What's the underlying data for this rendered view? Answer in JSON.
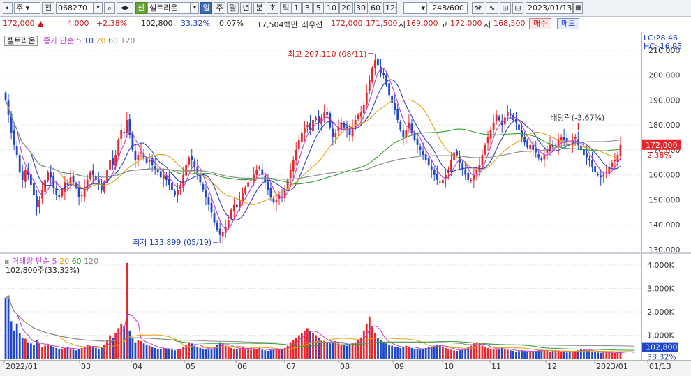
{
  "toolbar": {
    "period_type": "주",
    "prev_label": "전",
    "code": "068270",
    "credit_badge": "신",
    "stock_name": "셀트리온",
    "periods": [
      "일",
      "주",
      "월",
      "년",
      "분",
      "초",
      "틱"
    ],
    "active_period": "일",
    "nums": [
      "1",
      "3",
      "5",
      "10",
      "20",
      "30",
      "60",
      "120"
    ],
    "count": "248/600",
    "date": "2023/01/13"
  },
  "quote": {
    "price": "172,000",
    "change_arrow": "▲",
    "change": "4,000",
    "change_pct": "+2.38%",
    "volume": "102,800",
    "volume_ratio": "33.32%",
    "turnover_pct": "0.07%",
    "trade_value": "17,504백만",
    "best_bid_label": "최우선",
    "best_ask": "172,000",
    "best_bid": "171,500",
    "open_label": "시",
    "open": "169,000",
    "high_label": "고",
    "high": "172,000",
    "low_label": "저",
    "low": "168,500",
    "buy_label": "매수",
    "sell_label": "매도"
  },
  "legend": {
    "name": "셀트리온",
    "ma_label": "종가 단순",
    "ma_periods": [
      "5",
      "10",
      "20",
      "60",
      "120"
    ],
    "vol_label": "거래량 단순",
    "vol_periods": [
      "5",
      "20",
      "60",
      "120"
    ],
    "vol_value": "102,800주(33.32%)"
  },
  "corner": {
    "lc": "LC:28.46",
    "hc": "HC:-16.95"
  },
  "annotations": {
    "high": "최고 207,110 (08/11)",
    "low": "최저 133,899 (05/19)",
    "dividend": "배당락(-3.67%)"
  },
  "price_tags": {
    "price": "172,000",
    "pct": "2.38%"
  },
  "volume_tags": {
    "volume": "102,800",
    "pct": "33.32%"
  },
  "colors": {
    "up": "#e8262b",
    "down": "#2147c9",
    "ma5": "#c23bd6",
    "ma10": "#2f3fbf",
    "ma20": "#e0a010",
    "ma60": "#2ea02e",
    "ma120": "#888888"
  },
  "chart_data": {
    "type": "candlestick",
    "x_ticks": [
      "2022/01",
      "03",
      "04",
      "05",
      "06",
      "07",
      "08",
      "09",
      "10",
      "11",
      "12",
      "2023/01",
      "01/13"
    ],
    "price_axis": {
      "ylim": [
        130000,
        215000
      ],
      "ticks": [
        "130,000",
        "140,000",
        "150,000",
        "160,000",
        "170,000",
        "180,000",
        "190,000",
        "200,000",
        "210,000"
      ]
    },
    "volume_axis": {
      "ylim": [
        0,
        4300
      ],
      "ticks": [
        "1,000K",
        "2,000K",
        "3,000K",
        "4,000K"
      ]
    },
    "close": [
      190000,
      184000,
      177000,
      172000,
      168000,
      161000,
      158000,
      162000,
      160000,
      156000,
      152000,
      147000,
      150000,
      154000,
      158000,
      161000,
      159000,
      155000,
      152000,
      151000,
      154000,
      157000,
      156000,
      159000,
      157000,
      155000,
      151000,
      152000,
      155000,
      158000,
      161000,
      160000,
      158000,
      156000,
      154000,
      157000,
      162000,
      166000,
      164000,
      168000,
      174000,
      178000,
      177000,
      182000,
      176000,
      170000,
      166000,
      168000,
      169000,
      167000,
      165000,
      166000,
      164000,
      162000,
      161000,
      159000,
      160000,
      158000,
      156000,
      154000,
      152000,
      154000,
      156000,
      160000,
      164000,
      167000,
      166000,
      163000,
      160000,
      157000,
      154000,
      151000,
      148000,
      145000,
      141000,
      138000,
      136000,
      137000,
      139000,
      142000,
      146000,
      148000,
      147000,
      150000,
      153000,
      155000,
      157000,
      158000,
      160000,
      162000,
      163000,
      160000,
      157000,
      154000,
      151000,
      149000,
      150000,
      152000,
      151000,
      154000,
      158000,
      162000,
      166000,
      170000,
      174000,
      177000,
      179000,
      180000,
      178000,
      182000,
      183000,
      181000,
      183000,
      185000,
      184000,
      179000,
      175000,
      177000,
      179000,
      181000,
      179000,
      178000,
      176000,
      179000,
      182000,
      184000,
      185000,
      188000,
      193000,
      198000,
      203000,
      206000,
      204000,
      201000,
      200000,
      196000,
      192000,
      189000,
      186000,
      182000,
      178000,
      175000,
      178000,
      181000,
      177000,
      174000,
      172000,
      170000,
      168000,
      166000,
      164000,
      162000,
      160000,
      158000,
      157000,
      158000,
      160000,
      162000,
      166000,
      169000,
      168000,
      165000,
      162000,
      160000,
      158000,
      158000,
      160000,
      162000,
      164000,
      168000,
      172000,
      175000,
      178000,
      181000,
      184000,
      182000,
      180000,
      183000,
      185000,
      184000,
      182000,
      181000,
      178000,
      175000,
      173000,
      171000,
      172000,
      170000,
      169000,
      167000,
      166000,
      168000,
      170000,
      172000,
      171000,
      172000,
      174000,
      175000,
      174000,
      173000,
      172000,
      174000,
      175000,
      172000,
      170000,
      168000,
      167000,
      166000,
      163000,
      161000,
      160000,
      159000,
      160000,
      161000,
      163000,
      165000,
      166000,
      168000,
      172000
    ],
    "volume_k": [
      2600,
      2700,
      1600,
      1200,
      1500,
      1100,
      900,
      850,
      700,
      650,
      600,
      800,
      650,
      500,
      550,
      600,
      550,
      500,
      450,
      420,
      400,
      450,
      500,
      420,
      380,
      350,
      400,
      450,
      500,
      600,
      550,
      500,
      450,
      420,
      500,
      600,
      800,
      1000,
      900,
      1100,
      1300,
      1500,
      1400,
      4100,
      1200,
      900,
      700,
      800,
      750,
      650,
      600,
      550,
      500,
      450,
      420,
      400,
      450,
      420,
      400,
      380,
      350,
      380,
      420,
      500,
      600,
      700,
      650,
      550,
      500,
      450,
      420,
      400,
      380,
      400,
      500,
      600,
      700,
      650,
      550,
      500,
      450,
      420,
      400,
      450,
      500,
      420,
      400,
      380,
      400,
      420,
      450,
      380,
      350,
      330,
      350,
      380,
      420,
      400,
      380,
      450,
      550,
      700,
      800,
      900,
      1000,
      1100,
      1200,
      1300,
      1200,
      1100,
      1000,
      900,
      800,
      750,
      700,
      650,
      700,
      750,
      650,
      600,
      580,
      550,
      600,
      650,
      700,
      800,
      900,
      1200,
      1500,
      1800,
      1400,
      1100,
      900,
      800,
      700,
      650,
      600,
      550,
      500,
      480,
      450,
      500,
      550,
      500,
      450,
      420,
      400,
      380,
      420,
      450,
      480,
      500,
      550,
      600,
      580,
      500,
      450,
      420,
      380,
      350,
      330,
      350,
      380,
      420,
      480,
      550,
      650,
      700,
      650,
      550,
      500,
      450,
      420,
      400,
      380,
      420,
      450,
      400,
      380,
      350,
      330,
      300,
      320,
      350,
      330,
      300,
      280,
      300,
      330,
      350,
      380,
      350,
      330,
      300,
      320,
      350,
      330,
      300,
      280,
      260,
      280,
      300,
      330,
      350,
      400,
      380,
      350,
      330,
      300,
      280,
      260,
      250,
      300,
      280,
      260,
      250,
      240,
      260,
      280,
      300,
      320,
      280,
      260,
      103
    ]
  }
}
